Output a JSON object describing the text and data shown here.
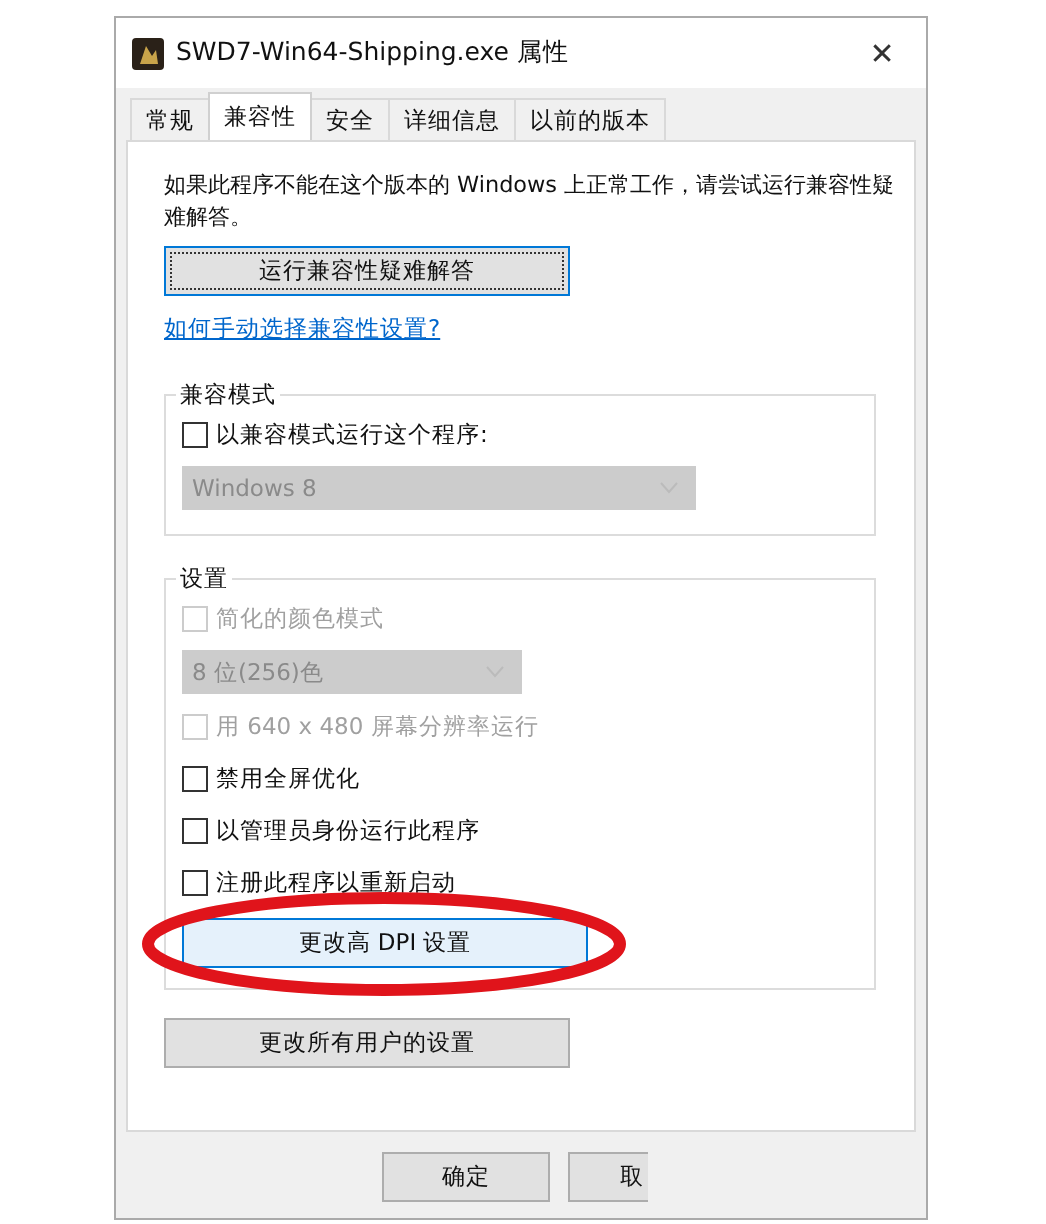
{
  "window": {
    "title": "SWD7-Win64-Shipping.exe 属性",
    "close": "✕"
  },
  "tabs": [
    {
      "label": "常规",
      "selected": false
    },
    {
      "label": "兼容性",
      "selected": true
    },
    {
      "label": "安全",
      "selected": false
    },
    {
      "label": "详细信息",
      "selected": false
    },
    {
      "label": "以前的版本",
      "selected": false
    }
  ],
  "intro": "如果此程序不能在这个版本的 Windows 上正常工作，请尝试运行兼容性疑难解答。",
  "troubleshoot_button": "运行兼容性疑难解答",
  "help_link": "如何手动选择兼容性设置?",
  "compat_mode": {
    "title": "兼容模式",
    "items": [
      {
        "kind": "checkbox",
        "label": "以兼容模式运行这个程序:",
        "checked": false,
        "disabled": false
      },
      {
        "kind": "dropdown",
        "value": "Windows 8",
        "disabled": true
      }
    ]
  },
  "settings": {
    "title": "设置",
    "items": [
      {
        "kind": "checkbox",
        "label": "简化的颜色模式",
        "checked": false,
        "disabled": true
      },
      {
        "kind": "dropdown",
        "value": "8 位(256)色",
        "disabled": true
      },
      {
        "kind": "checkbox",
        "label": "用 640 x 480 屏幕分辨率运行",
        "checked": false,
        "disabled": true
      },
      {
        "kind": "checkbox",
        "label": "禁用全屏优化",
        "checked": false,
        "disabled": false
      },
      {
        "kind": "checkbox",
        "label": "以管理员身份运行此程序",
        "checked": false,
        "disabled": false
      },
      {
        "kind": "checkbox",
        "label": "注册此程序以重新启动",
        "checked": false,
        "disabled": false
      },
      {
        "kind": "button",
        "label": "更改高 DPI 设置",
        "highlighted": true
      }
    ]
  },
  "all_users_button": "更改所有用户的设置",
  "footer_buttons": [
    "确定",
    "取"
  ]
}
